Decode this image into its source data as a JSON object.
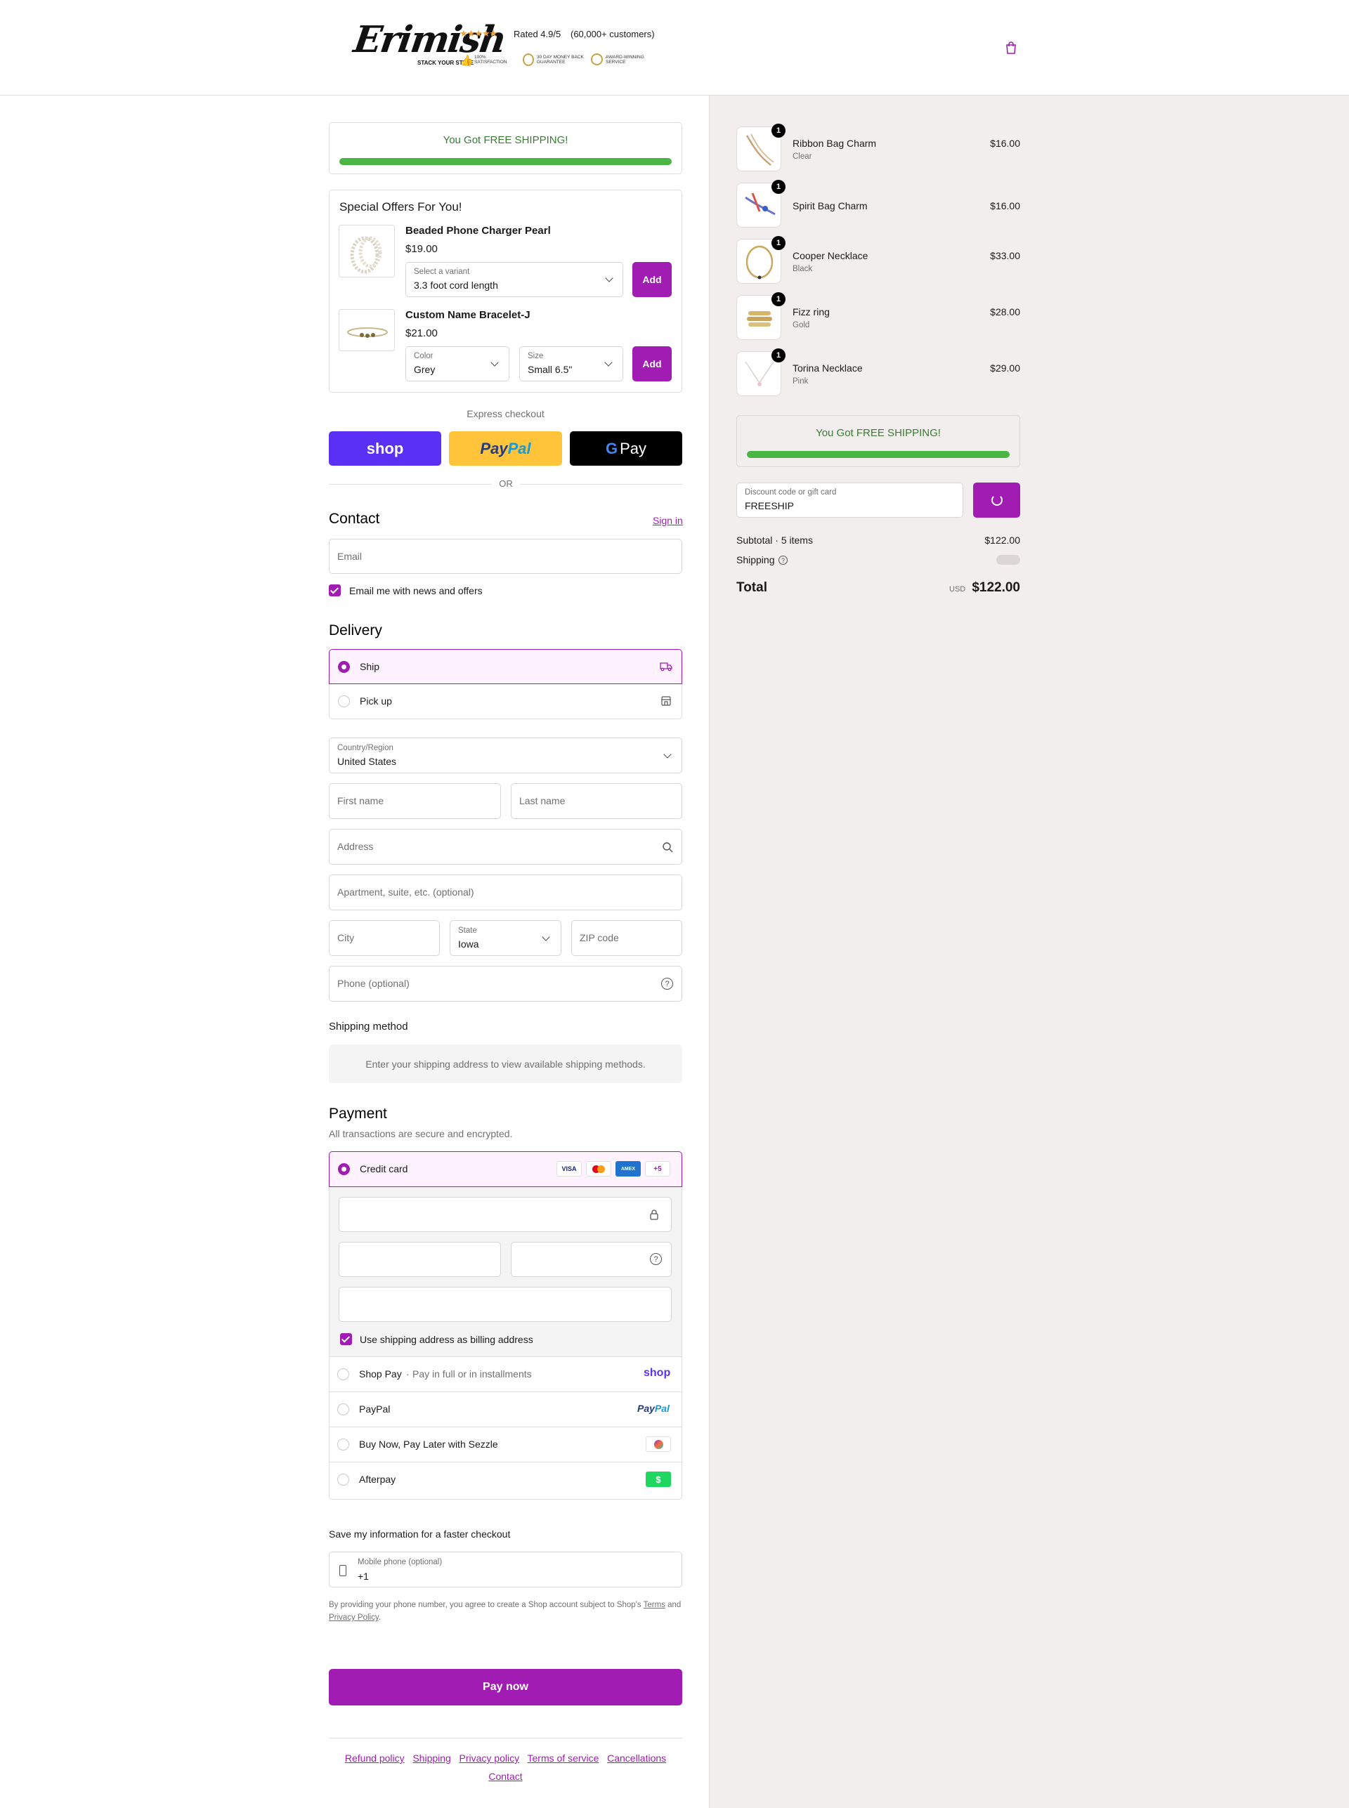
{
  "header": {
    "logo_text": "Erimish",
    "logo_tagline": "STACK YOUR STYLE",
    "stars": "★★★★★",
    "rating_text": "Rated 4.9/5",
    "customers_text": "(60,000+ customers)",
    "badges": [
      "100% SATISFACTION",
      "30 DAY MONEY BACK GUARANTEE",
      "AWARD-WINNING SERVICE"
    ]
  },
  "free_shipping": {
    "text": "You Got FREE SHIPPING!",
    "progress": 1.0
  },
  "offers": {
    "title": "Special Offers For You!",
    "items": [
      {
        "name": "Beaded Phone Charger Pearl",
        "price": "$19.00",
        "variant_label": "Select a variant",
        "variant_value": "3.3 foot cord length",
        "add_label": "Add"
      },
      {
        "name": "Custom Name Bracelet-J",
        "price": "$21.00",
        "color_label": "Color",
        "color_value": "Grey",
        "size_label": "Size",
        "size_value": "Small 6.5\"",
        "add_label": "Add"
      }
    ]
  },
  "express": {
    "title": "Express checkout",
    "shop_label": "shop",
    "paypal_label_a": "Pay",
    "paypal_label_b": "Pal",
    "gpay_label": "Pay",
    "or": "OR"
  },
  "contact": {
    "title": "Contact",
    "sign_in": "Sign in",
    "email_placeholder": "Email",
    "news_label": "Email me with news and offers"
  },
  "delivery": {
    "title": "Delivery",
    "options": [
      {
        "label": "Ship"
      },
      {
        "label": "Pick up"
      }
    ],
    "country_label": "Country/Region",
    "country_value": "United States",
    "first_name": "First name",
    "last_name": "Last name",
    "address": "Address",
    "apartment": "Apartment, suite, etc. (optional)",
    "city": "City",
    "state_label": "State",
    "state_value": "Iowa",
    "zip": "ZIP code",
    "phone": "Phone (optional)"
  },
  "shipping_method": {
    "title": "Shipping method",
    "message": "Enter your shipping address to view available shipping methods."
  },
  "payment": {
    "title": "Payment",
    "subtitle": "All transactions are secure and encrypted.",
    "credit_card": "Credit card",
    "card_brands": [
      "VISA",
      "AMEX"
    ],
    "more_brands": "+5",
    "billing_label": "Use shipping address as billing address",
    "methods": [
      {
        "label": "Shop Pay",
        "sub": "Pay in full or in installments",
        "logo": "shop"
      },
      {
        "label": "PayPal",
        "logo_a": "Pay",
        "logo_b": "Pal"
      },
      {
        "label": "Buy Now, Pay Later with Sezzle"
      },
      {
        "label": "Afterpay",
        "logo": "$"
      }
    ]
  },
  "save_info": {
    "title": "Save my information for a faster checkout",
    "mobile_label": "Mobile phone (optional)",
    "mobile_value": "+1",
    "disclaimer_a": "By providing your phone number, you agree to create a Shop account subject to Shop's",
    "terms": "Terms",
    "and": "and",
    "privacy": "Privacy Policy",
    "period": "."
  },
  "pay_now": "Pay now",
  "footer_links": [
    "Refund policy",
    "Shipping",
    "Privacy policy",
    "Terms of service",
    "Cancellations",
    "Contact"
  ],
  "cart": {
    "items": [
      {
        "name": "Ribbon Bag Charm",
        "variant": "Clear",
        "price": "$16.00",
        "qty": "1"
      },
      {
        "name": "Spirit Bag Charm",
        "variant": "",
        "price": "$16.00",
        "qty": "1"
      },
      {
        "name": "Cooper Necklace",
        "variant": "Black",
        "price": "$33.00",
        "qty": "1"
      },
      {
        "name": "Fizz ring",
        "variant": "Gold",
        "price": "$28.00",
        "qty": "1"
      },
      {
        "name": "Torina Necklace",
        "variant": "Pink",
        "price": "$29.00",
        "qty": "1"
      }
    ],
    "free_shipping": "You Got FREE SHIPPING!",
    "discount_label": "Discount code or gift card",
    "discount_value": "FREESHIP",
    "subtotal_label": "Subtotal · 5 items",
    "subtotal_value": "$122.00",
    "shipping_label": "Shipping",
    "total_label": "Total",
    "currency": "USD",
    "total_value": "$122.00"
  },
  "colors": {
    "accent": "#a11cb3",
    "green": "#4bb543",
    "shop_purple": "#5a31f4",
    "paypal_yellow": "#ffc439"
  }
}
